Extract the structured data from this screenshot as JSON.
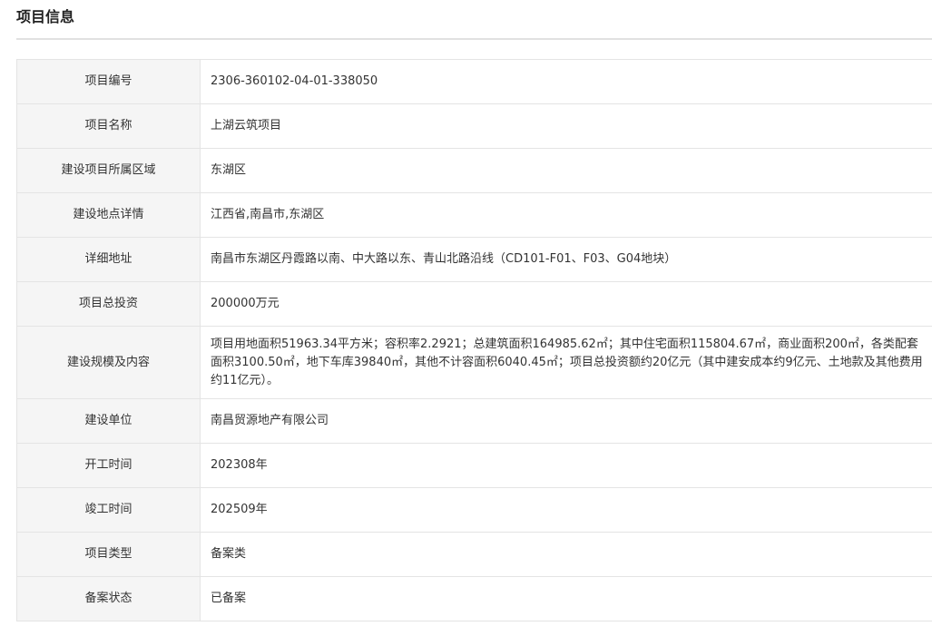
{
  "section": {
    "title": "项目信息"
  },
  "rows": [
    {
      "label": "项目编号",
      "value": "2306-360102-04-01-338050"
    },
    {
      "label": "项目名称",
      "value": "上湖云筑项目"
    },
    {
      "label": "建设项目所属区域",
      "value": "东湖区"
    },
    {
      "label": "建设地点详情",
      "value": "江西省,南昌市,东湖区"
    },
    {
      "label": "详细地址",
      "value": "南昌市东湖区丹霞路以南、中大路以东、青山北路沿线（CD101-F01、F03、G04地块）"
    },
    {
      "label": "项目总投资",
      "value": "200000万元"
    },
    {
      "label": "建设规模及内容",
      "value": "项目用地面积51963.34平方米；容积率2.2921；总建筑面积164985.62㎡；其中住宅面积115804.67㎡，商业面积200㎡，各类配套面积3100.50㎡，地下车库39840㎡，其他不计容面积6040.45㎡；项目总投资额约20亿元（其中建安成本约9亿元、土地款及其他费用约11亿元）。"
    },
    {
      "label": "建设单位",
      "value": "南昌贸源地产有限公司"
    },
    {
      "label": "开工时间",
      "value": "202308年"
    },
    {
      "label": "竣工时间",
      "value": "202509年"
    },
    {
      "label": "项目类型",
      "value": "备案类"
    },
    {
      "label": "备案状态",
      "value": "已备案"
    }
  ]
}
